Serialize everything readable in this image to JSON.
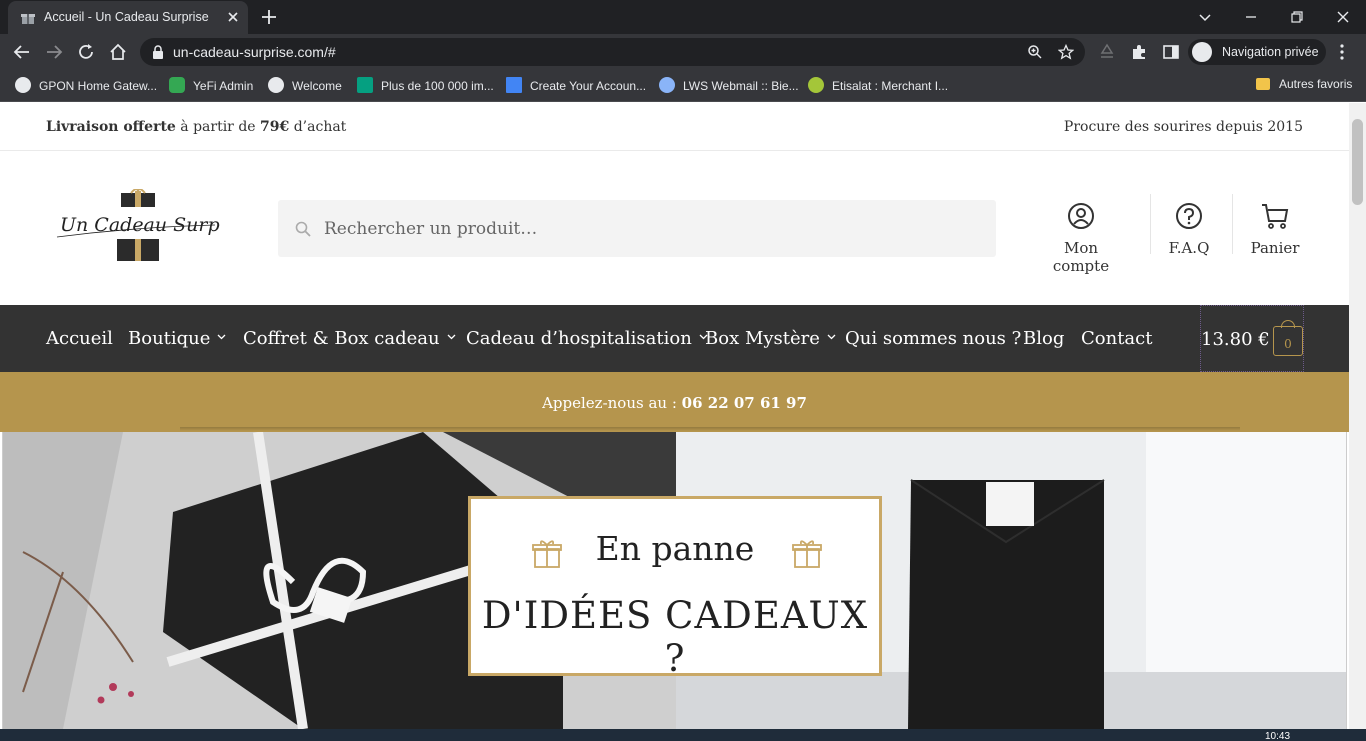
{
  "browser": {
    "tab_title": "Accueil - Un Cadeau Surprise",
    "url": "un-cadeau-surprise.com/#",
    "profile_label": "Navigation privée",
    "bookmarks": [
      {
        "label": "GPON Home Gatew...",
        "color": "#e8eaed"
      },
      {
        "label": "YeFi Admin",
        "color": "#34a853"
      },
      {
        "label": "Welcome",
        "color": "#e8eaed"
      },
      {
        "label": "Plus de 100 000 im...",
        "color": "#05a081"
      },
      {
        "label": "Create Your Accoun...",
        "color": "#4285f4"
      },
      {
        "label": "LWS Webmail :: Bie...",
        "color": "#8ab4f8"
      },
      {
        "label": "Etisalat : Merchant I...",
        "color": "#a4c639"
      }
    ],
    "other_bookmarks": "Autres favoris"
  },
  "site": {
    "topbar": {
      "promo_bold": "Livraison offerte",
      "promo_mid": " à partir de ",
      "promo_amount": "79€",
      "promo_end": " d’achat",
      "tagline": "Procure des sourires depuis 2015"
    },
    "logo_text": "Un Cadeau Surprise",
    "search": {
      "placeholder": "Rechercher un produit…"
    },
    "header_links": {
      "account": "Mon compte",
      "faq": "F.A.Q",
      "cart": "Panier"
    },
    "nav": [
      {
        "label": "Accueil",
        "dropdown": false
      },
      {
        "label": "Boutique",
        "dropdown": true
      },
      {
        "label": "Coffret & Box cadeau",
        "dropdown": true
      },
      {
        "label": "Cadeau d’hospitalisation",
        "dropdown": true
      },
      {
        "label": "Box Mystère",
        "dropdown": true
      },
      {
        "label": "Qui sommes nous ?",
        "dropdown": false
      },
      {
        "label": "Blog",
        "dropdown": false
      },
      {
        "label": "Contact",
        "dropdown": false
      }
    ],
    "cart": {
      "total": "13.80 €",
      "count": "0"
    },
    "callbar": {
      "prefix": "Appelez-nous au : ",
      "phone": "06 22 07 61 97"
    },
    "hero": {
      "line1": "En panne",
      "line2": "D'IDÉES CADEAUX ?"
    },
    "colors": {
      "gold": "#b5954d",
      "dark": "#333333"
    }
  },
  "taskbar": {
    "clock": "10:43"
  }
}
